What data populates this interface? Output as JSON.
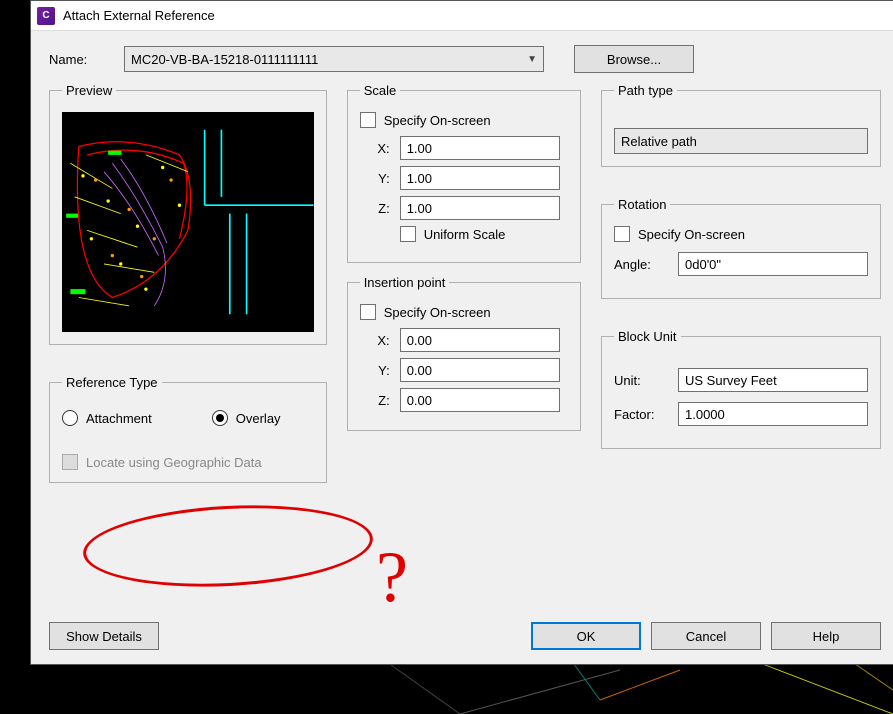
{
  "title": "Attach External Reference",
  "name": {
    "label": "Name:",
    "value": "MC20-VB-BA-15218-0111111111",
    "browse": "Browse..."
  },
  "preview": {
    "legend": "Preview"
  },
  "reference_type": {
    "legend": "Reference Type",
    "attachment": "Attachment",
    "overlay": "Overlay",
    "selected": "overlay",
    "locate_geo": "Locate using Geographic Data"
  },
  "scale": {
    "legend": "Scale",
    "specify": "Specify On-screen",
    "x_label": "X:",
    "x": "1.00",
    "y_label": "Y:",
    "y": "1.00",
    "z_label": "Z:",
    "z": "1.00",
    "uniform": "Uniform Scale"
  },
  "insertion": {
    "legend": "Insertion point",
    "specify": "Specify On-screen",
    "x_label": "X:",
    "x": "0.00",
    "y_label": "Y:",
    "y": "0.00",
    "z_label": "Z:",
    "z": "0.00"
  },
  "path_type": {
    "legend": "Path type",
    "value": "Relative path"
  },
  "rotation": {
    "legend": "Rotation",
    "specify": "Specify On-screen",
    "angle_label": "Angle:",
    "angle": "0d0'0\""
  },
  "block_unit": {
    "legend": "Block Unit",
    "unit_label": "Unit:",
    "unit": "US Survey Feet",
    "factor_label": "Factor:",
    "factor": "1.0000"
  },
  "footer": {
    "show_details": "Show Details",
    "ok": "OK",
    "cancel": "Cancel",
    "help": "Help"
  },
  "app_icon_letter": "C"
}
